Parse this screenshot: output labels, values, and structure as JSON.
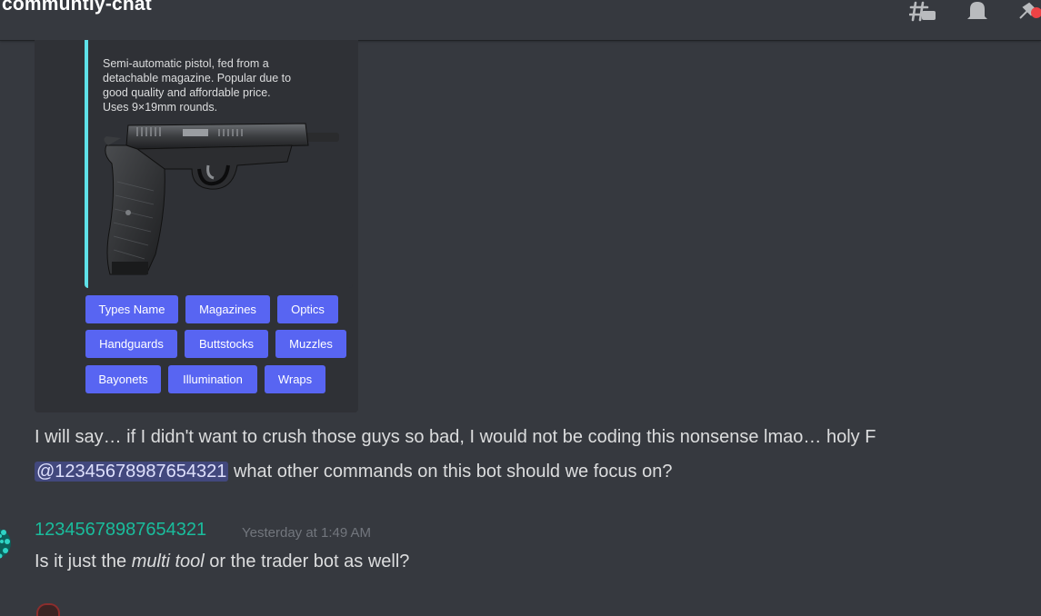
{
  "header": {
    "channel_name": "communtiy-chat",
    "icons": [
      "threads-icon",
      "bell-icon",
      "pin-icon"
    ]
  },
  "embed": {
    "description": "Semi-automatic pistol, fed from a\ndetachable magazine. Popular due to\ngood quality and affordable price.\nUses 9×19mm rounds.",
    "accent_color": "#5ee1e8",
    "buttons": [
      [
        "Types Name",
        "Magazines",
        "Optics"
      ],
      [
        "Handguards",
        "Buttstocks",
        "Muzzles"
      ],
      [
        "Bayonets",
        "Illumination",
        "Wraps"
      ]
    ],
    "button_color": "#5865f2"
  },
  "messages": {
    "line1": "I will say… if I didn't want to crush those guys so bad, I would not be coding this nonsense lmao… holy F",
    "mention": "@12345678987654321",
    "line2_rest": " what other commands on this bot should we focus on?",
    "reply": {
      "author": "12345678987654321",
      "author_color": "#1abc9c",
      "timestamp": "Yesterday at 1:49 AM",
      "text_before": "Is it just the ",
      "text_italic": "multi tool",
      "text_after": " or the trader bot as well?"
    }
  }
}
